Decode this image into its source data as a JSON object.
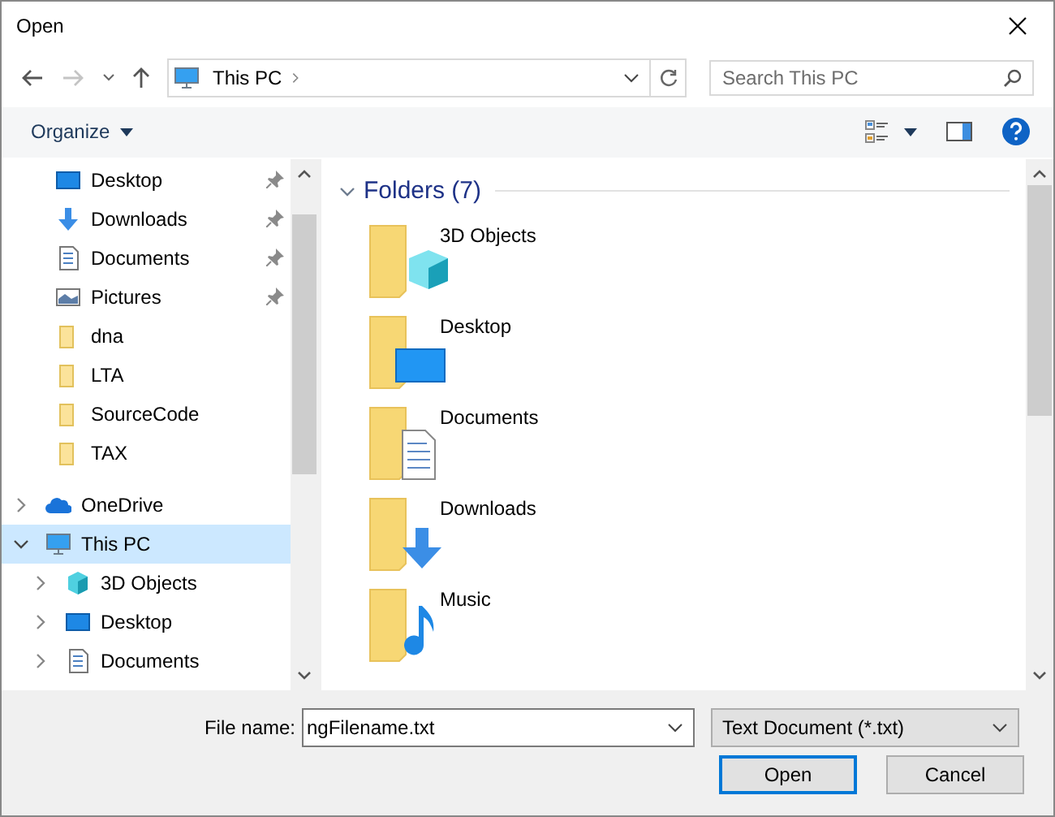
{
  "window": {
    "title": "Open"
  },
  "navigation": {
    "back_disabled": false,
    "forward_disabled": true,
    "address": {
      "segments": [
        "This PC"
      ]
    },
    "search": {
      "placeholder": "Search This PC"
    }
  },
  "toolbar": {
    "organize": "Organize"
  },
  "nav_pane": {
    "quick_access_items": [
      {
        "label": "Desktop",
        "kind": "desktop",
        "pinned": true
      },
      {
        "label": "Downloads",
        "kind": "downloads",
        "pinned": true
      },
      {
        "label": "Documents",
        "kind": "documents",
        "pinned": true
      },
      {
        "label": "Pictures",
        "kind": "pictures",
        "pinned": true
      },
      {
        "label": "dna",
        "kind": "folder",
        "pinned": false
      },
      {
        "label": "LTA",
        "kind": "folder",
        "pinned": false
      },
      {
        "label": "SourceCode",
        "kind": "folder",
        "pinned": false
      },
      {
        "label": "TAX",
        "kind": "folder",
        "pinned": false
      }
    ],
    "tree": [
      {
        "label": "OneDrive",
        "kind": "cloud",
        "expanded": false,
        "selected": false
      },
      {
        "label": "This PC",
        "kind": "pc",
        "expanded": true,
        "selected": true,
        "children": [
          {
            "label": "3D Objects",
            "kind": "objects3d",
            "expanded": false,
            "selected": false
          },
          {
            "label": "Desktop",
            "kind": "desktop",
            "expanded": false,
            "selected": false
          },
          {
            "label": "Documents",
            "kind": "documents",
            "expanded": false,
            "selected": false
          }
        ]
      }
    ]
  },
  "content": {
    "groups": [
      {
        "title": "Folders (7)",
        "expanded": true,
        "items": [
          {
            "label": "3D Objects",
            "kind": "objects3d"
          },
          {
            "label": "Desktop",
            "kind": "desktop"
          },
          {
            "label": "Documents",
            "kind": "documents"
          },
          {
            "label": "Downloads",
            "kind": "downloads"
          },
          {
            "label": "Music",
            "kind": "music"
          }
        ]
      }
    ]
  },
  "footer": {
    "file_name_label": "File name:",
    "file_name_value": "ngFilename.txt",
    "file_type": "Text Document (*.txt)",
    "buttons": [
      {
        "label": "Open",
        "default": true
      },
      {
        "label": "Cancel",
        "default": false
      }
    ]
  }
}
